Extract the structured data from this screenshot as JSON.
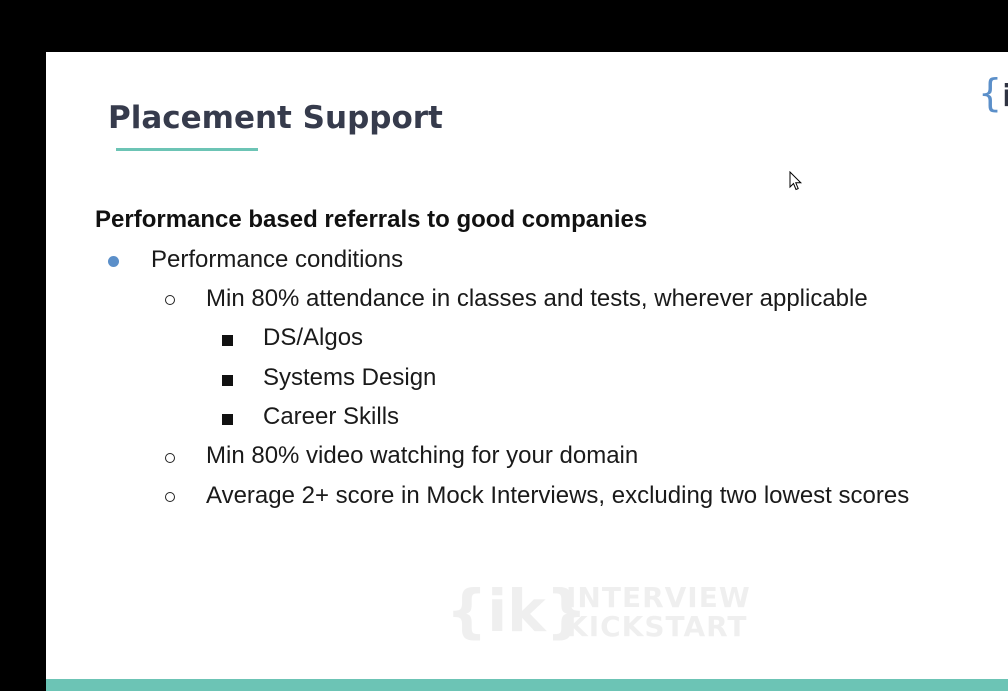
{
  "slide": {
    "title": "Placement Support",
    "heading": "Performance based referrals to good companies",
    "logo": {
      "brace": "{",
      "letters": "iK"
    },
    "bullets": [
      {
        "level": 1,
        "text": "Performance conditions"
      },
      {
        "level": 2,
        "text": "Min 80% attendance in classes and tests, wherever applicable"
      },
      {
        "level": 3,
        "text": "DS/Algos"
      },
      {
        "level": 3,
        "text": "Systems Design"
      },
      {
        "level": 3,
        "text": "Career Skills"
      },
      {
        "level": 2,
        "text": "Min 80% video watching for your domain"
      },
      {
        "level": 2,
        "text": "Average 2+ score in Mock Interviews, excluding two lowest scores"
      }
    ],
    "watermark": {
      "mark": "{ik}",
      "line1": "INTERVIEW",
      "line2": "KICKSTART"
    }
  },
  "colors": {
    "accent_teal": "#6cc4b5",
    "bullet_blue": "#5b8fc9",
    "title_text": "#363b4c"
  },
  "icons": {
    "cursor": "mouse-pointer-icon",
    "level1_marker": "filled-circle-bullet",
    "level2_marker": "hollow-circle-bullet",
    "level3_marker": "filled-square-bullet"
  }
}
